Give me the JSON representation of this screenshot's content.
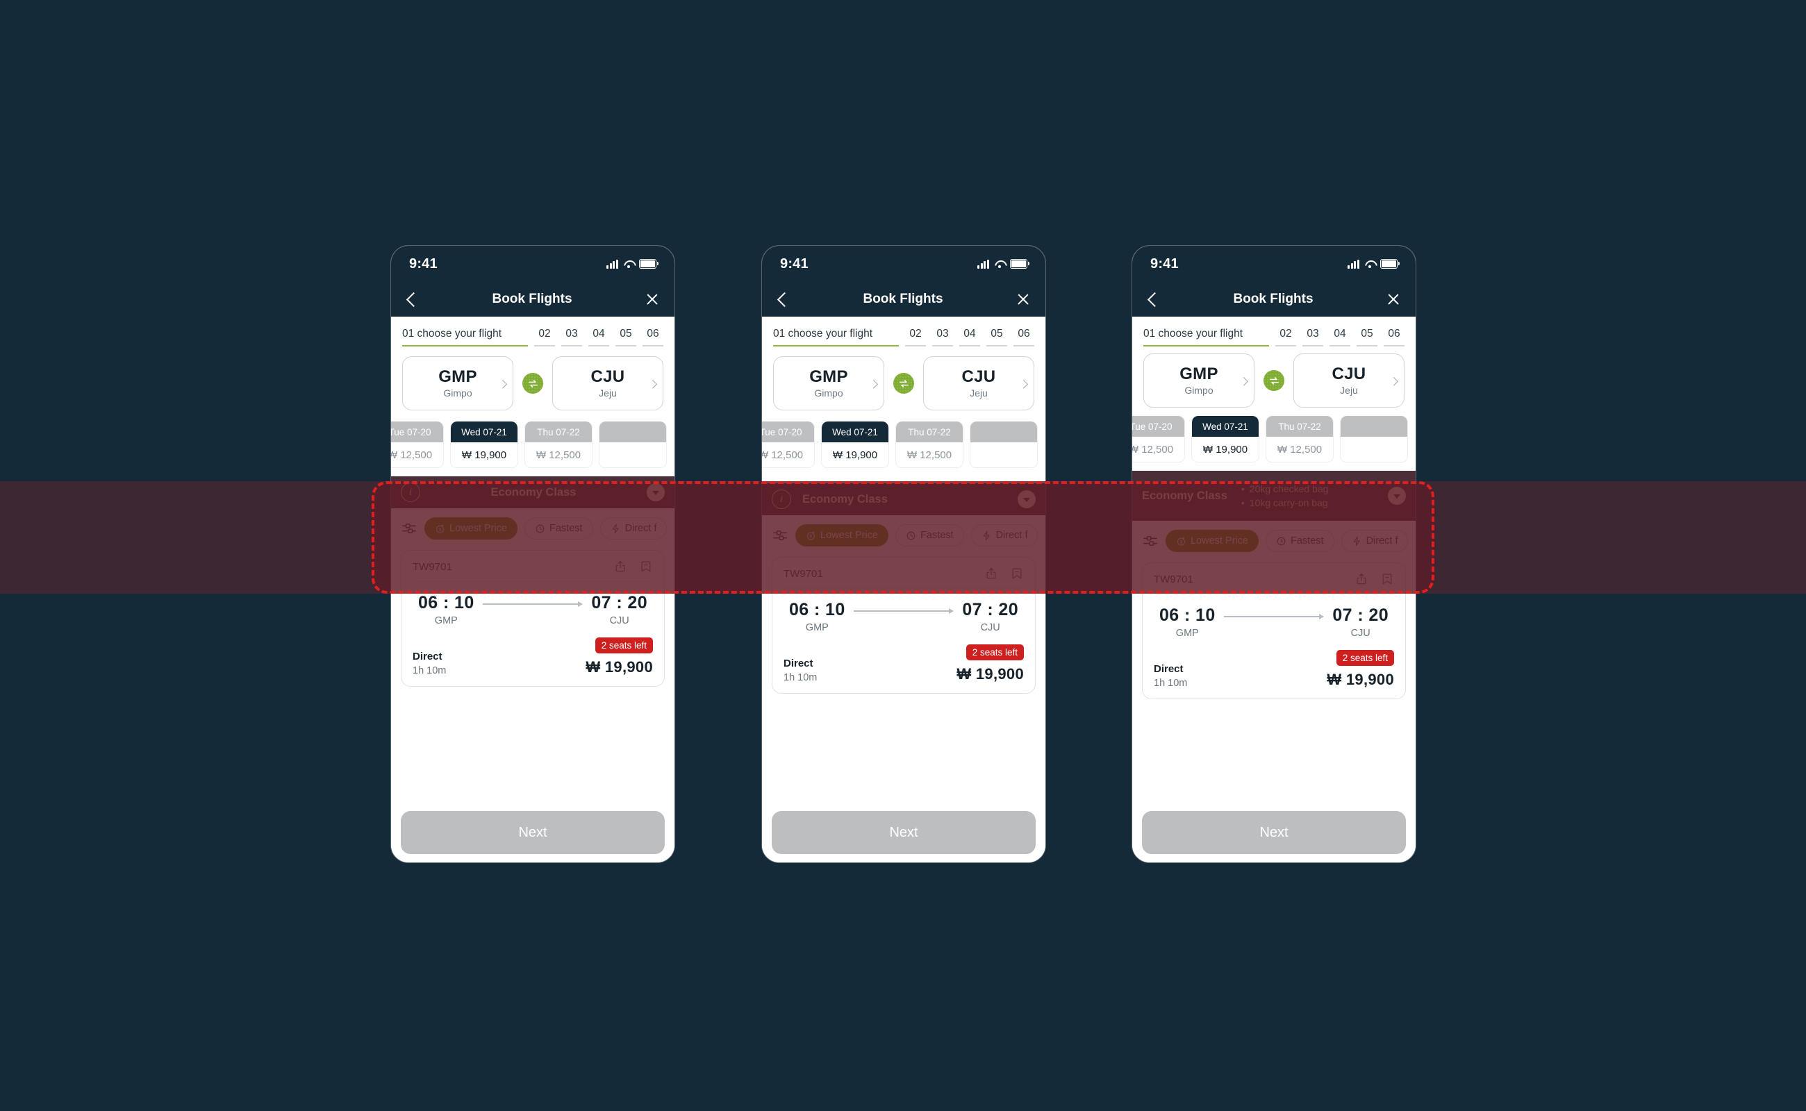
{
  "background_color": "#152a38",
  "status_bar": {
    "time": "9:41",
    "signal_icon": "cellular-signal-icon",
    "wifi_icon": "wifi-icon",
    "battery_icon": "battery-icon"
  },
  "nav": {
    "back_icon": "chevron-left-icon",
    "title": "Book Flights",
    "close_icon": "close-x-icon"
  },
  "steps": {
    "active_label": "01 choose your flight",
    "numbers": [
      "02",
      "03",
      "04",
      "05",
      "06"
    ],
    "active_color": "#8fb83e"
  },
  "route": {
    "origin": {
      "code": "GMP",
      "city": "Gimpo",
      "chevron": "chevron-right-icon"
    },
    "destination": {
      "code": "CJU",
      "city": "Jeju",
      "chevron": "chevron-right-icon"
    },
    "swap_icon": "swap-arrows-icon",
    "swap_color": "#7fad33"
  },
  "dates": [
    {
      "label": "Tue 07-20",
      "price": "₩ 12,500",
      "selected": false
    },
    {
      "label": "Wed 07-21",
      "price": "₩ 19,900",
      "selected": true
    },
    {
      "label": "Thu 07-22",
      "price": "₩ 12,500",
      "selected": false
    }
  ],
  "class_bar": {
    "info_icon": "info-circle-icon",
    "label": "Economy Class",
    "caret_icon": "chevron-down-circle-icon",
    "bags": [
      "20kg checked bag",
      "10kg carry-on bag"
    ],
    "bg_color": "#4a2f38"
  },
  "filters": {
    "slider_icon": "filter-sliders-icon",
    "chips": [
      {
        "label": "Lowest Price",
        "icon": "dollar-circle-icon",
        "active": true
      },
      {
        "label": "Fastest",
        "icon": "clock-icon",
        "active": false
      },
      {
        "label": "Direct f",
        "icon": "lightning-bolt-icon",
        "active": false
      }
    ],
    "active_color": "#6d8c11"
  },
  "flight_card": {
    "code": "TW9701",
    "share_icon": "share-icon",
    "bookmark_icon": "bookmark-minus-icon",
    "depart_time": "06 : 10",
    "depart_airport": "GMP",
    "arrow_icon": "arrow-right-icon",
    "arrive_time": "07 : 20",
    "arrive_airport": "CJU",
    "stops": "Direct",
    "duration": "1h 10m",
    "seats_badge": "2 seats left",
    "seats_color": "#cf2020",
    "price": "₩ 19,900"
  },
  "next_button": {
    "label": "Next"
  },
  "annotation": {
    "border_color": "#e02020",
    "style": "dashed-highlight-box"
  }
}
